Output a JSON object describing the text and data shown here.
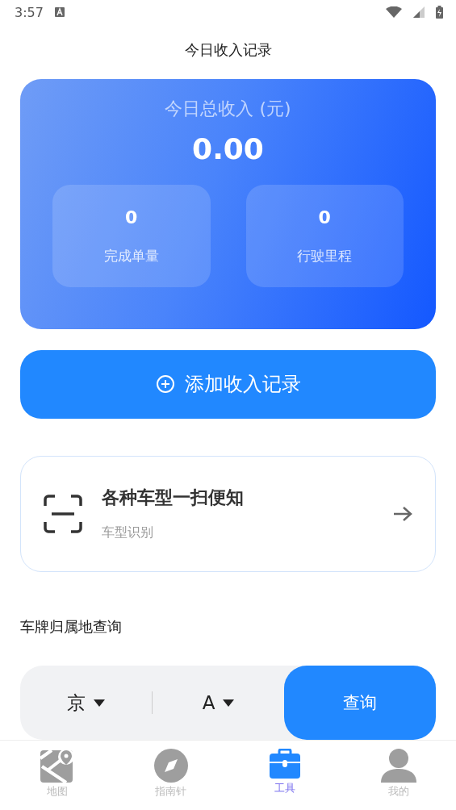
{
  "status_bar": {
    "time": "3:57"
  },
  "header": {
    "title": "今日收入记录"
  },
  "income_card": {
    "label": "今日总收入 (元)",
    "amount": "0.00",
    "stats": [
      {
        "value": "0",
        "label": "完成单量"
      },
      {
        "value": "0",
        "label": "行驶里程"
      }
    ]
  },
  "add_button": {
    "label": "添加收入记录"
  },
  "scan_card": {
    "title": "各种车型一扫便知",
    "subtitle": "车型识别"
  },
  "plate_query": {
    "title": "车牌归属地查询",
    "province": "京",
    "letter": "A",
    "button": "查询"
  },
  "tab_bar": [
    {
      "label": "地图",
      "kind": "map",
      "selected": false
    },
    {
      "label": "指南针",
      "kind": "compass",
      "selected": false
    },
    {
      "label": "工具",
      "kind": "toolbox",
      "selected": true
    },
    {
      "label": "我的",
      "kind": "person",
      "selected": false
    }
  ]
}
